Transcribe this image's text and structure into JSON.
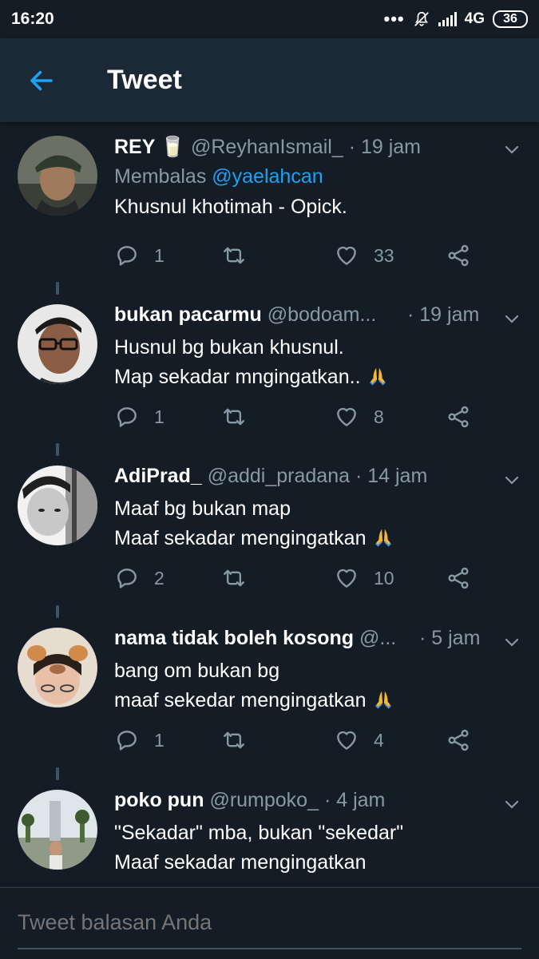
{
  "status_bar": {
    "time": "16:20",
    "dots": "•••",
    "network": "4G",
    "battery": "36"
  },
  "appbar": {
    "title": "Tweet"
  },
  "colors": {
    "background": "#141d26",
    "appbar": "#1b2836",
    "accent": "#1da1f2",
    "secondary_text": "#8899a6"
  },
  "tweets": [
    {
      "name": "REY 🥛",
      "handle": "@ReyhanIsmail_",
      "time": "· 19 jam",
      "reply_prefix": "Membalas ",
      "reply_to": "@yaelahcan",
      "lines": [
        "Khusnul khotimah - Opick."
      ],
      "replies": "1",
      "retweets": "",
      "likes": "33"
    },
    {
      "name": "bukan pacarmu",
      "handle": "@bodoam...",
      "time": "· 19 jam",
      "lines": [
        "Husnul bg bukan khusnul.",
        "Map sekadar mngingatkan.. "
      ],
      "replies": "1",
      "retweets": "",
      "likes": "8"
    },
    {
      "name": "AdiPrad_",
      "handle": "@addi_pradana",
      "time": "· 14 jam",
      "lines": [
        "Maaf bg bukan map",
        "Maaf sekadar mengingatkan "
      ],
      "replies": "2",
      "retweets": "",
      "likes": "10"
    },
    {
      "name": "nama tidak boleh kosong",
      "handle": "@...",
      "time": "· 5 jam",
      "lines": [
        "bang om bukan bg",
        "maaf sekedar mengingatkan "
      ],
      "replies": "1",
      "retweets": "",
      "likes": "4"
    },
    {
      "name": "poko pun",
      "handle": "@rumpoko_",
      "time": "· 4 jam",
      "lines": [
        "\"Sekadar\" mba, bukan \"sekedar\"",
        "Maaf sekadar mengingatkan"
      ]
    }
  ],
  "composer": {
    "placeholder": "Tweet balasan Anda"
  }
}
